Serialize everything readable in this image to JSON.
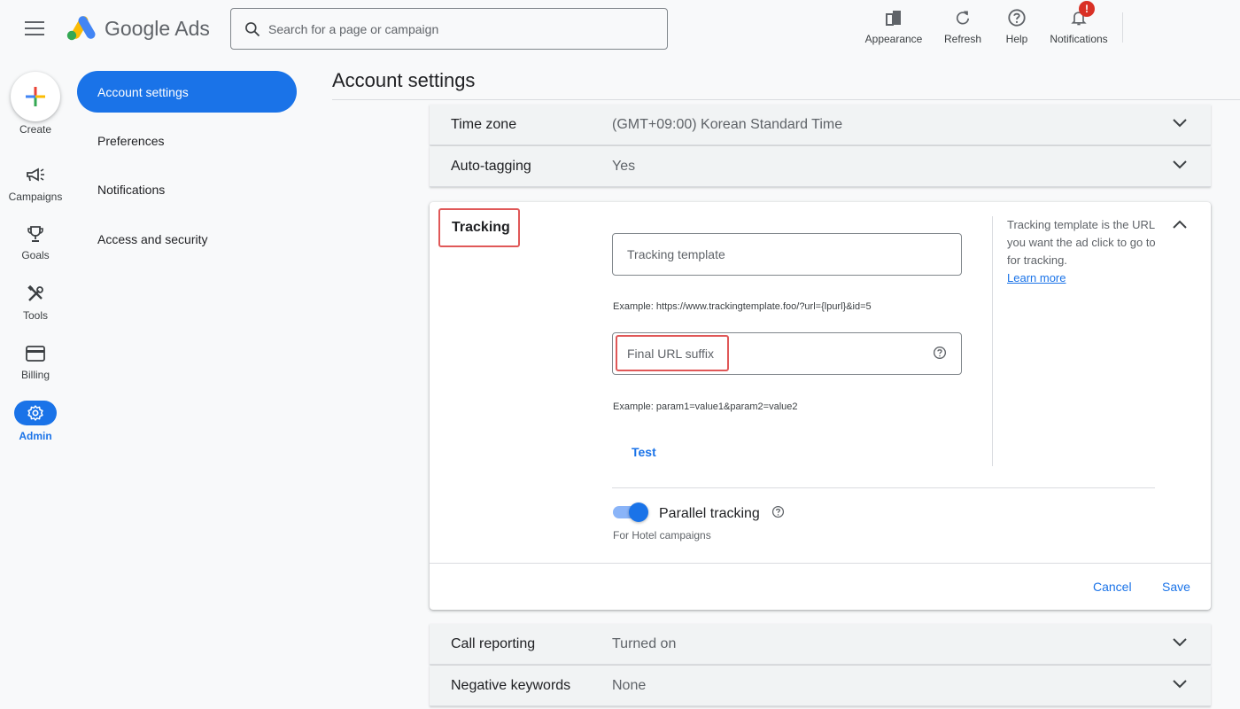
{
  "app": {
    "brand": "Google Ads",
    "logo_icon": "google-ads-logo-icon"
  },
  "search": {
    "placeholder": "Search for a page or campaign"
  },
  "toolbar": {
    "appearance": "Appearance",
    "refresh": "Refresh",
    "help": "Help",
    "notifications": "Notifications",
    "notifications_badge": "!"
  },
  "rail": {
    "create": "Create",
    "campaigns": "Campaigns",
    "goals": "Goals",
    "tools": "Tools",
    "billing": "Billing",
    "admin": "Admin"
  },
  "nav": {
    "items": [
      {
        "label": "Account settings",
        "active": true
      },
      {
        "label": "Preferences",
        "active": false
      },
      {
        "label": "Notifications",
        "active": false
      },
      {
        "label": "Access and security",
        "active": false
      }
    ]
  },
  "page": {
    "title": "Account settings"
  },
  "settings": {
    "time_zone": {
      "label": "Time zone",
      "value": "(GMT+09:00) Korean Standard Time"
    },
    "auto_tagging": {
      "label": "Auto-tagging",
      "value": "Yes"
    },
    "call_reporting": {
      "label": "Call reporting",
      "value": "Turned on"
    },
    "negative_keywords": {
      "label": "Negative keywords",
      "value": "None"
    }
  },
  "tracking": {
    "title": "Tracking",
    "template_placeholder": "Tracking template",
    "template_example": "Example: https://www.trackingtemplate.foo/?url={lpurl}&id=5",
    "suffix_placeholder": "Final URL suffix",
    "suffix_example": "Example: param1=value1&param2=value2",
    "test_label": "Test",
    "help_text": "Tracking template is the URL you want the ad click to go to for tracking.",
    "help_link": "Learn more",
    "parallel_label": "Parallel tracking",
    "parallel_sub": "For Hotel campaigns",
    "parallel_enabled": true,
    "cancel_label": "Cancel",
    "save_label": "Save"
  },
  "colors": {
    "accent": "#1a73e8",
    "highlight_box": "#e05858"
  }
}
